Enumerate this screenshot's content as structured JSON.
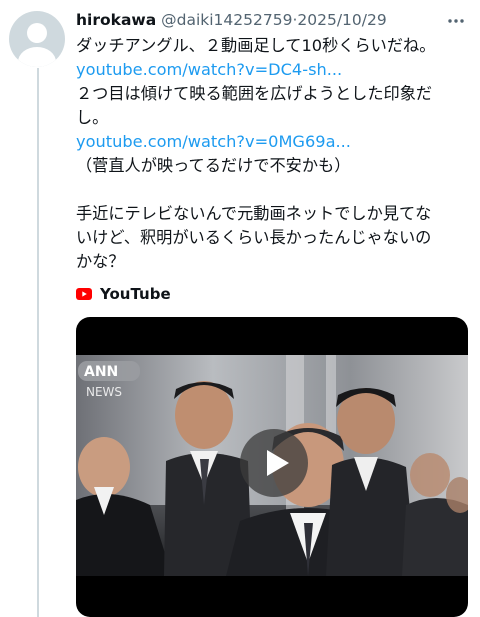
{
  "tweet": {
    "author_name": "hirokawa",
    "author_handle": "@daiki14252759",
    "separator": "·",
    "date": "2025/10/29",
    "lines": [
      "ダッチアングル、２動画足して10秒くらいだね。",
      "youtube.com/watch?v=DC4-sh...",
      "２つ目は傾けて映る範囲を広げようとした印象だ",
      "し。",
      "youtube.com/watch?v=0MG69a...",
      "（菅直人が映ってるだけで不安かも）",
      "",
      "手近にテレビないんで元動画ネットでしか見てな",
      "いけど、釈明がいるくらい長かったんじゃないの",
      "かな？"
    ]
  },
  "card": {
    "source_label": "YouTube",
    "news_logo": "ANN",
    "news_logo_sub": "NEWS"
  },
  "icons": {
    "more": "more-horizontal-icon",
    "source": "youtube-icon",
    "play": "play-icon"
  },
  "colors": {
    "link": "#1d9bf0",
    "secondary_text": "#536471",
    "youtube_red": "#ff0000"
  }
}
